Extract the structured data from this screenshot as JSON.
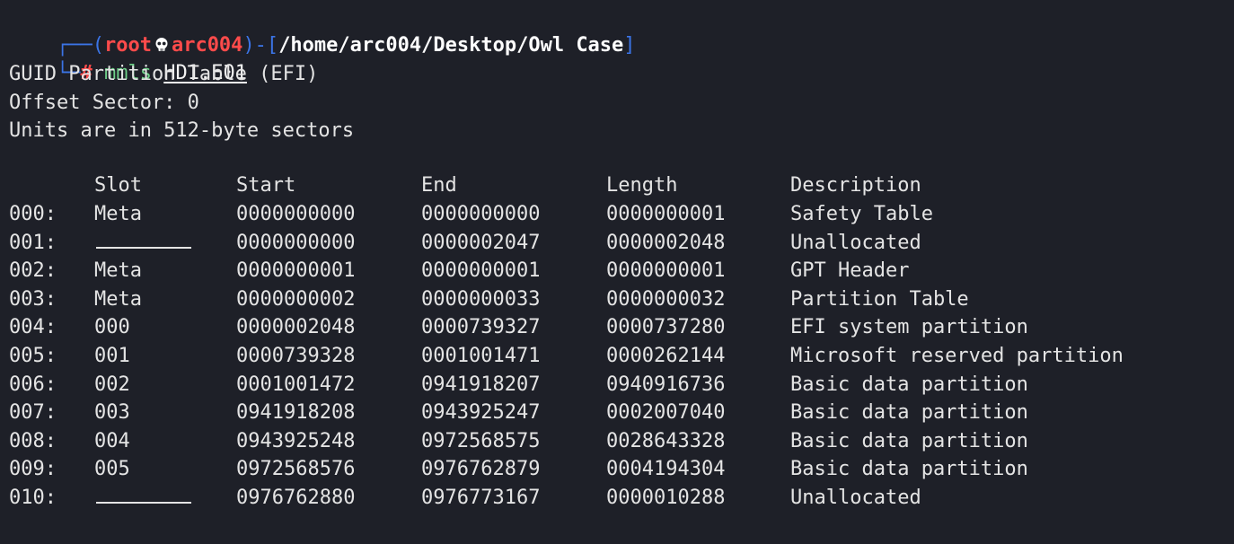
{
  "prompt": {
    "open_corner": "┌──(",
    "user": "root",
    "host": "arc004",
    "mid": ")-[",
    "path": "/home/arc004/Desktop/Owl Case",
    "close_bracket": "]",
    "second_corner": "└─",
    "hash": "#",
    "command": "mmls",
    "argument": "HD1.E01"
  },
  "output_header": [
    "GUID Partition Table (EFI)",
    "Offset Sector: 0",
    "Units are in 512-byte sectors"
  ],
  "table": {
    "columns": [
      "Slot",
      "Start",
      "End",
      "Length",
      "Description"
    ],
    "rows": [
      {
        "idx": "000:",
        "slot": "Meta",
        "start": "0000000000",
        "end": "0000000000",
        "length": "0000000001",
        "desc": "Safety Table"
      },
      {
        "idx": "001:",
        "slot": "",
        "start": "0000000000",
        "end": "0000002047",
        "length": "0000002048",
        "desc": "Unallocated"
      },
      {
        "idx": "002:",
        "slot": "Meta",
        "start": "0000000001",
        "end": "0000000001",
        "length": "0000000001",
        "desc": "GPT Header"
      },
      {
        "idx": "003:",
        "slot": "Meta",
        "start": "0000000002",
        "end": "0000000033",
        "length": "0000000032",
        "desc": "Partition Table"
      },
      {
        "idx": "004:",
        "slot": "000",
        "start": "0000002048",
        "end": "0000739327",
        "length": "0000737280",
        "desc": "EFI system partition"
      },
      {
        "idx": "005:",
        "slot": "001",
        "start": "0000739328",
        "end": "0001001471",
        "length": "0000262144",
        "desc": "Microsoft reserved partition"
      },
      {
        "idx": "006:",
        "slot": "002",
        "start": "0001001472",
        "end": "0941918207",
        "length": "0940916736",
        "desc": "Basic data partition"
      },
      {
        "idx": "007:",
        "slot": "003",
        "start": "0941918208",
        "end": "0943925247",
        "length": "0002007040",
        "desc": "Basic data partition"
      },
      {
        "idx": "008:",
        "slot": "004",
        "start": "0943925248",
        "end": "0972568575",
        "length": "0028643328",
        "desc": "Basic data partition"
      },
      {
        "idx": "009:",
        "slot": "005",
        "start": "0972568576",
        "end": "0976762879",
        "length": "0004194304",
        "desc": "Basic data partition"
      },
      {
        "idx": "010:",
        "slot": "",
        "start": "0976762880",
        "end": "0976773167",
        "length": "0000010288",
        "desc": "Unallocated"
      }
    ]
  },
  "colors": {
    "background": "#1e2028",
    "prompt_frame": "#3b74e6",
    "user_host": "#ff4b4b",
    "command": "#6fd28a",
    "text": "#e4e4e4"
  },
  "icons": {
    "separator": "skull-icon"
  }
}
